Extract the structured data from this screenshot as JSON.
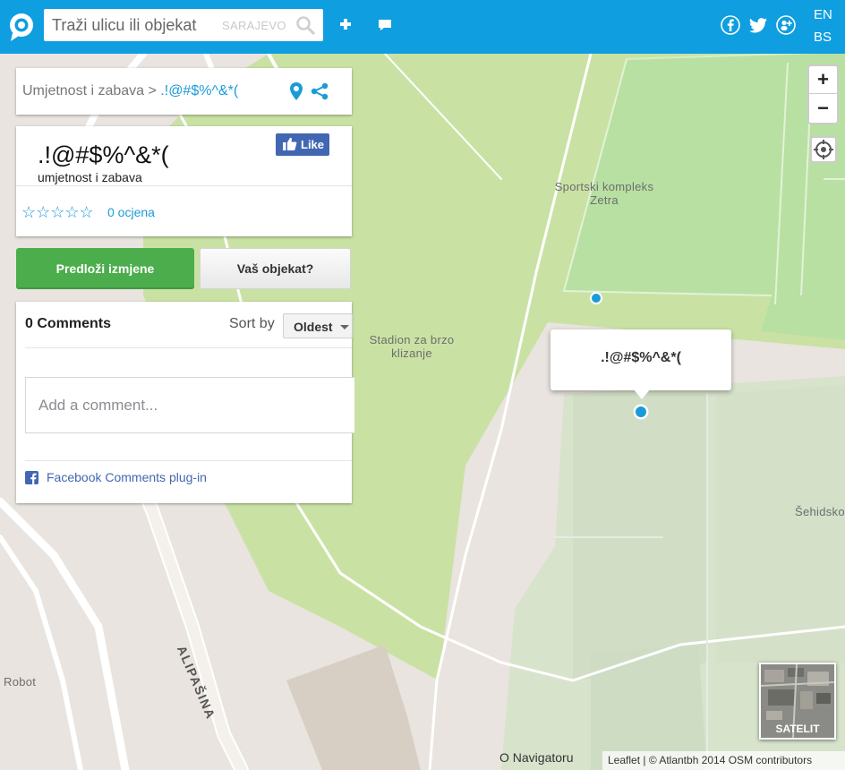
{
  "header": {
    "search_placeholder": "Traži ulicu ili objekat",
    "city": "SARAJEVO",
    "languages": [
      "EN",
      "BS"
    ]
  },
  "breadcrumb": {
    "category": "Umjetnost i zabava",
    "separator": " > ",
    "current": ".!@#$%^&*("
  },
  "place": {
    "title": ".!@#$%^&*(",
    "category": "umjetnost i zabava",
    "like_label": "Like",
    "stars": "☆☆☆☆☆",
    "rating_count": "0 ocjena"
  },
  "actions": {
    "suggest_label": "Predloži izmjene",
    "owner_label": "Vaš objekat?"
  },
  "comments": {
    "count_label": "0 Comments",
    "sort_label": "Sort by",
    "sort_value": "Oldest",
    "input_placeholder": "Add a comment...",
    "plugin_label": "Facebook Comments plug-in"
  },
  "map": {
    "labels": {
      "sports_complex": "Sportski kompleks\nZetra",
      "stadium": "Stadion za brzo\nklizanje",
      "street": "ALIPAŠINA",
      "robot": "Robot",
      "sehidsko": "Šehidsko"
    },
    "popup_text": ".!@#$%^&*(",
    "zoom_in": "+",
    "zoom_out": "−",
    "satellite_label": "SATELIT",
    "about": "O Navigatoru",
    "attribution": "Leaflet | © Atlantbh 2014 OSM contributors",
    "colors": {
      "park": "#c9e2a4",
      "pitch": "#b6e0a0",
      "land": "#e9e4df",
      "road": "#ffffff",
      "marker": "#1a9bd7"
    }
  }
}
